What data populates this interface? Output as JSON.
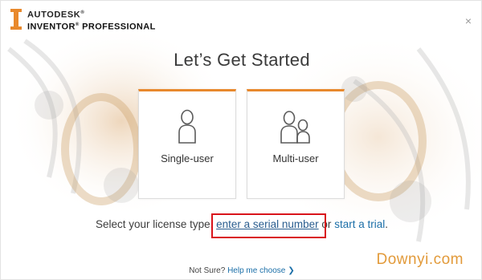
{
  "brand": {
    "line1": "AUTODESK",
    "line1_mark": "®",
    "line2": "INVENTOR",
    "line2_mark": "®",
    "line2_rest": " PROFESSIONAL"
  },
  "window": {
    "close_label": "×"
  },
  "title": "Let’s Get Started",
  "cards": [
    {
      "label": "Single-user",
      "icon": "single-user-icon"
    },
    {
      "label": "Multi-user",
      "icon": "multi-user-icon"
    }
  ],
  "license": {
    "prefix": "Select your license type, ",
    "serial_link": "enter a serial number",
    "middle": " or ",
    "trial_link": "start a trial",
    "suffix": "."
  },
  "help": {
    "prefix": "Not Sure? ",
    "link": "Help me choose",
    "chevron": "❯"
  },
  "watermark": "Downyi.com",
  "colors": {
    "accent": "#e8892d",
    "link": "#1b6fa8",
    "highlight": "#d9141b"
  }
}
